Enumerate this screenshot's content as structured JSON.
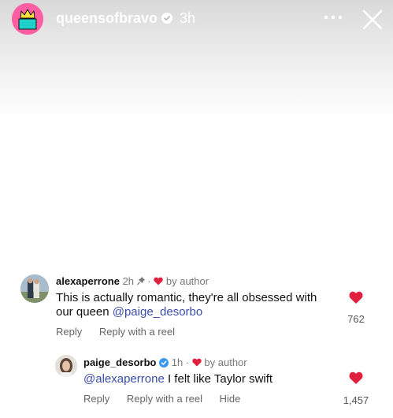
{
  "story": {
    "username": "queensofbravo",
    "time": "3h"
  },
  "comments": [
    {
      "username": "alexaperrone",
      "time": "2h",
      "by_author": "by author",
      "text": "This is actually romantic, they're all obsessed with our queen",
      "mention": "@paige_desorbo",
      "likes": "762",
      "actions": {
        "reply": "Reply",
        "reply_reel": "Reply with a reel"
      }
    },
    {
      "username": "paige_desorbo",
      "time": "1h",
      "by_author": "by author",
      "mention": "@alexaperrone",
      "text": "I felt like Taylor swift",
      "likes": "1,457",
      "actions": {
        "reply": "Reply",
        "reply_reel": "Reply with a reel",
        "hide": "Hide"
      }
    }
  ],
  "colors": {
    "heart": "#e0203c",
    "mention": "#3a4da8",
    "avatar_bg": "#ff5fa2",
    "verified": "#3897f0"
  }
}
